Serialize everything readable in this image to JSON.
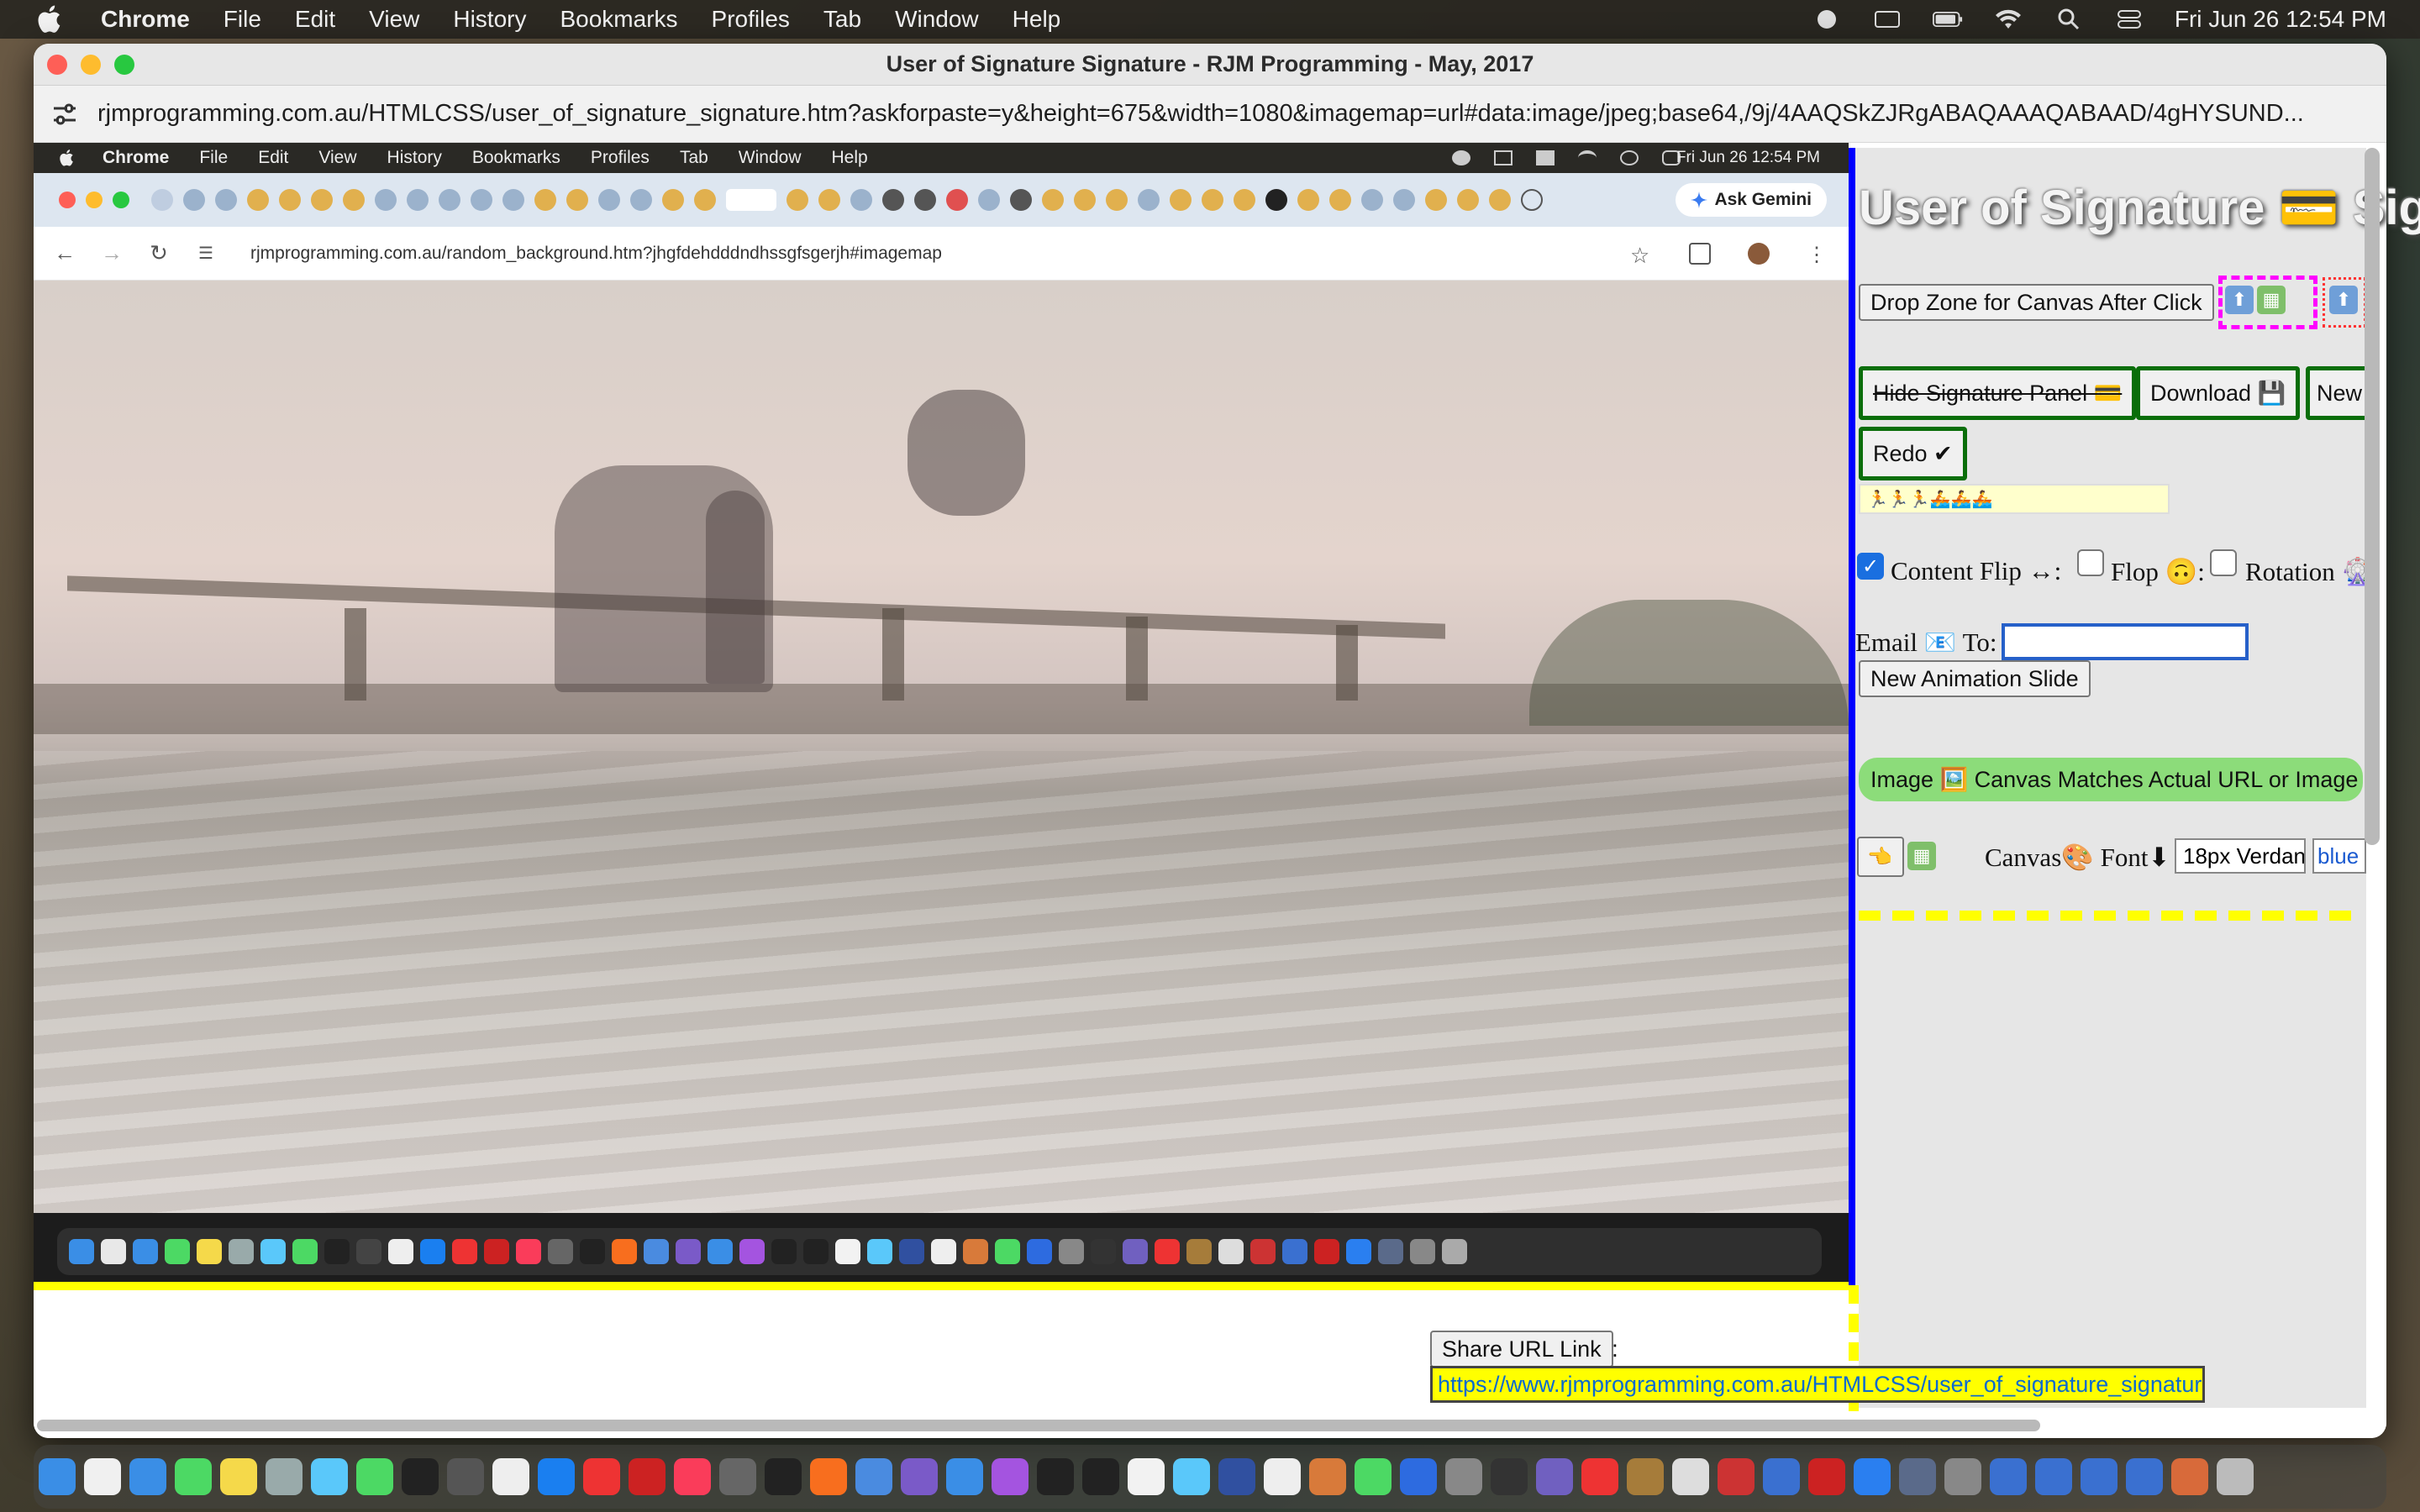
{
  "menubar": {
    "app": "Chrome",
    "items": [
      "File",
      "Edit",
      "View",
      "History",
      "Bookmarks",
      "Profiles",
      "Tab",
      "Window",
      "Help"
    ],
    "clock": "Fri Jun 26  12:54 PM"
  },
  "window": {
    "title": "User of Signature Signature - RJM Programming - May, 2017",
    "url": "rjmprogramming.com.au/HTMLCSS/user_of_signature_signature.htm?askforpaste=y&height=675&width=1080&imagemap=url#data:image/jpeg;base64,/9j/4AAQSkZJRgABAQAAAQABAAD/4gHYSUND..."
  },
  "embedded": {
    "menubar": {
      "app": "Chrome",
      "items": [
        "File",
        "Edit",
        "View",
        "History",
        "Bookmarks",
        "Profiles",
        "Tab",
        "Window",
        "Help"
      ],
      "clock": "Fri Jun 26  12:54 PM"
    },
    "ask_gemini": "Ask Gemini",
    "url": "rjmprogramming.com.au/random_background.htm?jhgfdehdddndhssgfsgerjh#imagemap"
  },
  "panel": {
    "title": "User of Signature 💳 Sig",
    "drop_zone": "Drop Zone for Canvas After Click",
    "hide_panel": "Hide Signature Panel 💳",
    "download": "Download 💾",
    "new": "New",
    "redo": "Redo ✔",
    "sig_strip": "🏃🏃🏃🚣🚣🚣",
    "content_flip": "Content Flip ↔:",
    "flop": "Flop 🙃:",
    "rotation": "Rotation 🎡",
    "email_label": "Email 📧 To:",
    "email_value": "",
    "new_slide": "New Animation Slide",
    "image_match": "Image 🖼️ Canvas Matches Actual URL or Image M",
    "canvas_font_label": "Canvas🎨 Font⬇",
    "font_value": "18px Verdana",
    "color_value": "blue"
  },
  "share": {
    "button": "Share URL Link",
    "colon": ":",
    "url": "https://www.rjmprogramming.com.au/HTMLCSS/user_of_signature_signature.htm"
  },
  "colors": {
    "accent_blue": "#0000ff",
    "highlight_yellow": "#ffff00",
    "magenta": "#ff00ff",
    "green_border": "#0a6e0a",
    "green_bar": "#8cdc7a"
  }
}
